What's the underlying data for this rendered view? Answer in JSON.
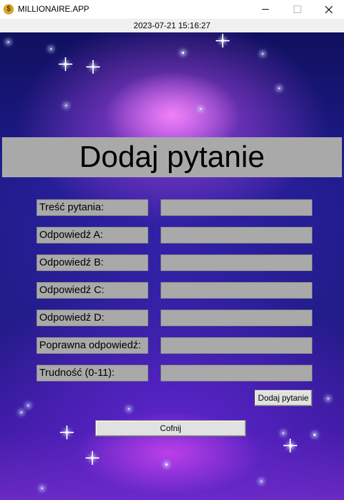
{
  "window": {
    "title": "MILLIONAIRE.APP",
    "icon": "dollar-coin-icon",
    "controls": [
      "minimize",
      "maximize",
      "close"
    ]
  },
  "clock": "2023-07-21 15:16:27",
  "heading": "Dodaj pytanie",
  "form": {
    "rows": [
      {
        "label": "Treść pytania:",
        "value": ""
      },
      {
        "label": "Odpowiedź A:",
        "value": ""
      },
      {
        "label": "Odpowiedź B:",
        "value": ""
      },
      {
        "label": "Odpowiedź C:",
        "value": ""
      },
      {
        "label": "Odpowiedź D:",
        "value": ""
      },
      {
        "label": "Poprawna odpowiedź:",
        "value": ""
      },
      {
        "label": "Trudność (0-11):",
        "value": ""
      }
    ],
    "submit_label": "Dodaj pytanie"
  },
  "back_label": "Cofnij",
  "colors": {
    "field_gray": "#a9a9a9",
    "button_gray": "#e1e1e1",
    "background": "galaxy purple/blue"
  }
}
